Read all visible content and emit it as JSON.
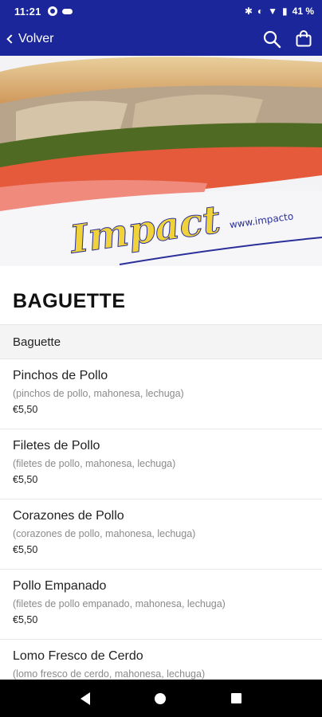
{
  "status_bar": {
    "time": "11:21",
    "battery": "41 %",
    "icons": [
      "notification-icon",
      "cloud-icon",
      "bluetooth-icon",
      "data-saver-icon",
      "wifi-icon",
      "battery-icon"
    ]
  },
  "app_bar": {
    "back_label": "Volver",
    "icons": [
      "search-icon",
      "shopping-bag-icon"
    ],
    "color": "#1a2699"
  },
  "hero": {
    "logo_text": "Impact",
    "url_text": "www.impacto"
  },
  "section": {
    "title": "BAGUETTE",
    "category": "Baguette"
  },
  "menu_items": [
    {
      "name": "Pinchos de Pollo",
      "desc": "(pinchos de pollo, mahonesa, lechuga)",
      "price": "€5,50"
    },
    {
      "name": "Filetes de Pollo",
      "desc": "(filetes de pollo, mahonesa, lechuga)",
      "price": "€5,50"
    },
    {
      "name": "Corazones de Pollo",
      "desc": "(corazones de pollo, mahonesa, lechuga)",
      "price": "€5,50"
    },
    {
      "name": "Pollo Empanado",
      "desc": "(filetes de pollo empanado, mahonesa, lechuga)",
      "price": "€5,50"
    },
    {
      "name": "Lomo Fresco de Cerdo",
      "desc": "(lomo fresco de cerdo, mahonesa, lechuga)",
      "price": ""
    }
  ],
  "nav_bar": {
    "icons": [
      "nav-back-icon",
      "nav-home-icon",
      "nav-recents-icon"
    ]
  }
}
